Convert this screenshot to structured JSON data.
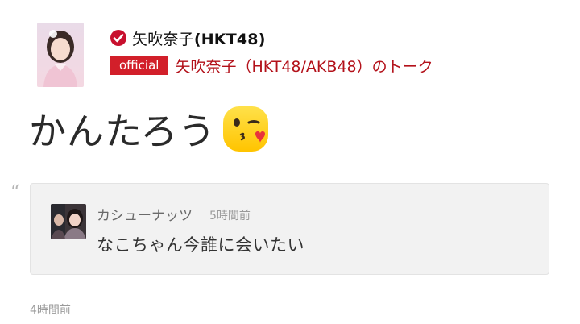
{
  "post": {
    "author_name": "矢吹奈子",
    "author_suffix": "(HKT48)",
    "official_badge": "official",
    "talk_title": "矢吹奈子（HKT48/AKB48）のトーク",
    "message": "かんたろう",
    "emoji": "kissing-face-emoji",
    "time": "4時間前"
  },
  "reply": {
    "author": "カシューナッツ",
    "time": "5時間前",
    "text": "なこちゃん今誰に会いたい"
  },
  "colors": {
    "accent": "#d21f2a",
    "link": "#b3111a",
    "card_bg": "#f2f2f2"
  },
  "icons": {
    "verified": "verified-check-icon",
    "quote": "quote-icon"
  }
}
